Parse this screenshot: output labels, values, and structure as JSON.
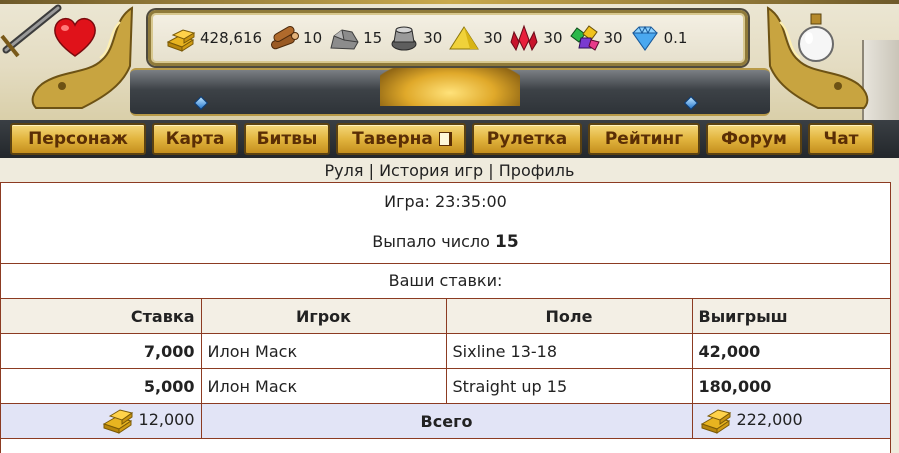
{
  "resources": [
    {
      "icon": "gold-bars-icon",
      "value": "428,616"
    },
    {
      "icon": "wood-logs-icon",
      "value": "10"
    },
    {
      "icon": "stone-icon",
      "value": "15"
    },
    {
      "icon": "iron-ore-icon",
      "value": "30"
    },
    {
      "icon": "sulfur-icon",
      "value": "30"
    },
    {
      "icon": "crystals-icon",
      "value": "30"
    },
    {
      "icon": "gems-icon",
      "value": "30"
    },
    {
      "icon": "diamond-icon",
      "value": "0.1"
    }
  ],
  "nav": [
    {
      "label": "Персонаж"
    },
    {
      "label": "Карта"
    },
    {
      "label": "Битвы"
    },
    {
      "label": "Таверна"
    },
    {
      "label": "Рулетка"
    },
    {
      "label": "Рейтинг"
    },
    {
      "label": "Форум"
    },
    {
      "label": "Чат"
    }
  ],
  "subnav": {
    "roulette": "Руля",
    "history": "История игр",
    "profile": "Профиль",
    "sep": "|"
  },
  "game": {
    "time_label": "Игра: 23:35:00",
    "result_label": "Выпало число",
    "result_number": "15",
    "bets_title": "Ваши ставки:"
  },
  "table": {
    "headers": {
      "bet": "Ставка",
      "player": "Игрок",
      "field": "Поле",
      "win": "Выигрыш"
    },
    "rows": [
      {
        "bet": "7,000",
        "player": "Илон Маск",
        "field": "Sixline 13-18",
        "win": "42,000"
      },
      {
        "bet": "5,000",
        "player": "Илон Маск",
        "field": "Straight up 15",
        "win": "180,000"
      }
    ],
    "total": {
      "bet": "12,000",
      "label": "Всего",
      "win": "222,000"
    }
  },
  "colors": {
    "accent_gold": "#e2b43e",
    "border": "#8c3b22",
    "total_bg": "#e2e4f6"
  }
}
